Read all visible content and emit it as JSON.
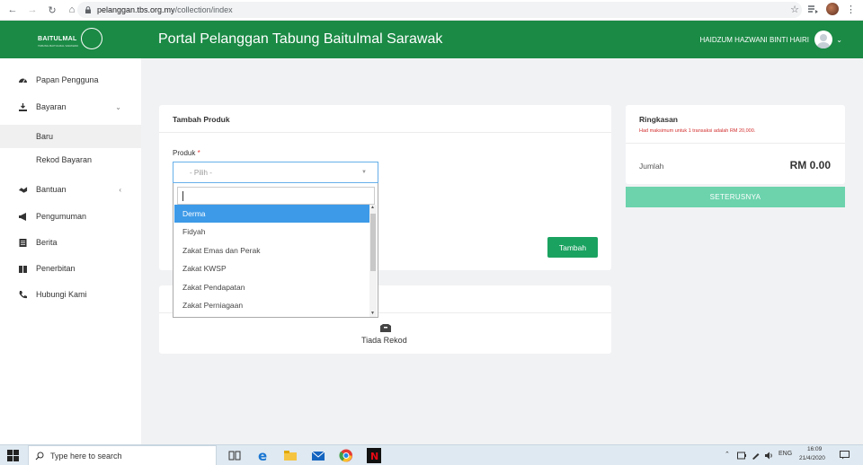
{
  "browser": {
    "url_host": "pelanggan.tbs.org.my",
    "url_path": "/collection/index",
    "star_icon": "star-icon",
    "menu_icon": "kebab-icon"
  },
  "header": {
    "logo_text": "BAITULMAL",
    "logo_subtext": "TABUNG BAITULMAL SARAWAK",
    "title": "Portal Pelanggan Tabung Baitulmal Sarawak",
    "user_name": "HAIDZUM HAZWANI BINTI HAIRI",
    "bg_color": "#1b8a45"
  },
  "sidebar": {
    "items": [
      {
        "label": "Papan Pengguna",
        "icon": "dashboard-icon"
      },
      {
        "label": "Bayaran",
        "icon": "payment-icon",
        "caret": "⌄"
      },
      {
        "label": "Baru"
      },
      {
        "label": "Rekod Bayaran"
      },
      {
        "label": "Bantuan",
        "icon": "help-icon",
        "caret": "‹"
      },
      {
        "label": "Pengumuman",
        "icon": "megaphone-icon"
      },
      {
        "label": "Berita",
        "icon": "news-icon"
      },
      {
        "label": "Penerbitan",
        "icon": "book-icon"
      },
      {
        "label": "Hubungi Kami",
        "icon": "phone-icon"
      }
    ]
  },
  "form": {
    "panel_title": "Tambah Produk",
    "field_label": "Produk",
    "required_mark": "*",
    "select_placeholder": "- Pilih -",
    "add_button": "Tambah",
    "options": [
      "Derma",
      "Fidyah",
      "Zakat Emas dan Perak",
      "Zakat KWSP",
      "Zakat Pendapatan",
      "Zakat Perniagaan"
    ],
    "selected_option": "Derma"
  },
  "records": {
    "empty_text": "Tiada Rekod"
  },
  "summary": {
    "title": "Ringkasan",
    "warning": "Had maksimum untuk 1 transaksi adalah RM 20,000.",
    "total_label": "Jumlah",
    "total_amount": "RM 0.00",
    "next_button": "SETERUSNYA"
  },
  "taskbar": {
    "search_placeholder": "Type here to search",
    "language": "ENG",
    "time": "16:09",
    "date": "21/4/2020"
  }
}
